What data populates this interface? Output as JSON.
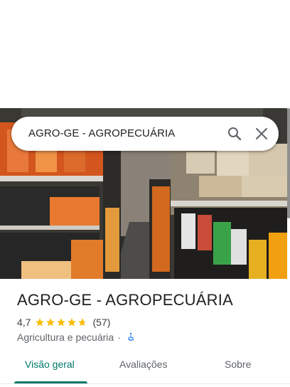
{
  "search": {
    "query": "AGRO-GE - AGROPECUÁRIA"
  },
  "place": {
    "title": "AGRO-GE - AGROPECUÁRIA",
    "rating": "4,7",
    "rating_value": 4.7,
    "reviews": "(57)",
    "category": "Agricultura e pecuária",
    "separator": "·",
    "accessibility_icon": "wheelchair-icon"
  },
  "tabs": [
    {
      "label": "Visão geral",
      "active": true
    },
    {
      "label": "Avaliações",
      "active": false
    },
    {
      "label": "Sobre",
      "active": false
    }
  ],
  "colors": {
    "accent": "#00796b",
    "star": "#fbbc04",
    "accessibility": "#1a73e8"
  }
}
